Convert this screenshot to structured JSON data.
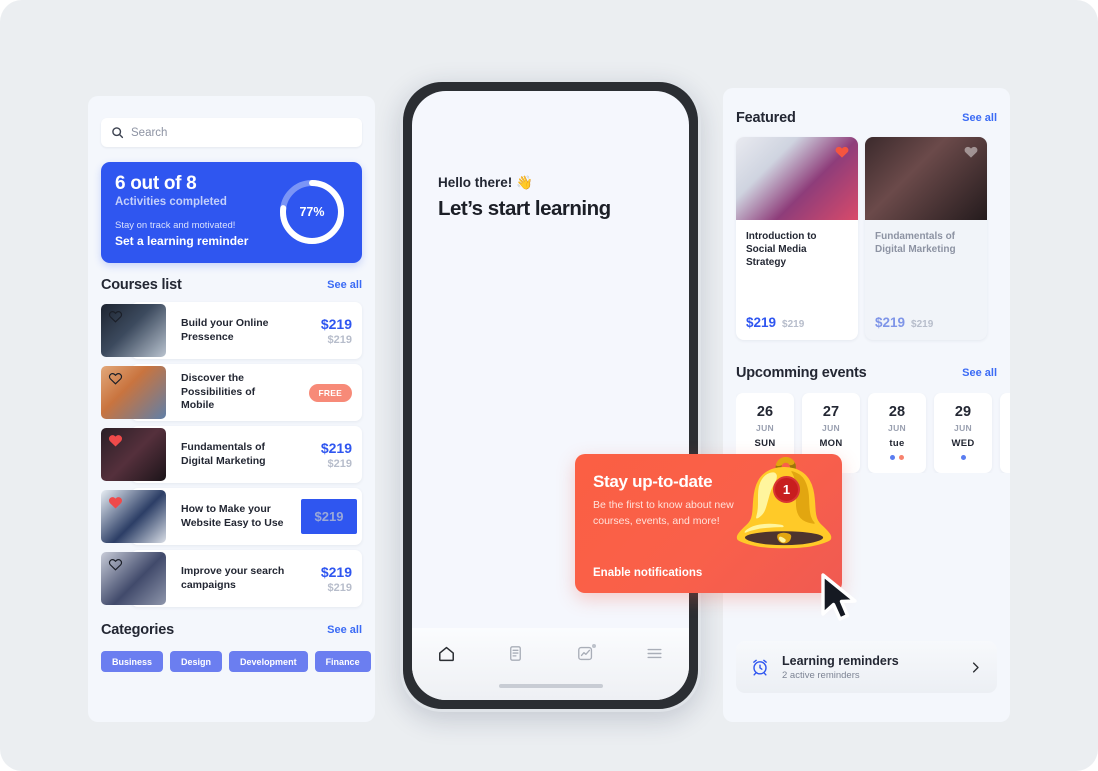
{
  "colors": {
    "background": "#ebeef1",
    "panel": "#f4f7fc",
    "accent_blue": "#2f56f0",
    "link_blue": "#3b6bf5",
    "chip_blue": "#6b7ef0",
    "coral": "#f78a78",
    "tooltip_red": "#f9604a",
    "text_dark": "#232733",
    "text_muted": "#8d93a3",
    "price_old": "#b7bdcb"
  },
  "left_panel": {
    "search": {
      "placeholder": "Search",
      "icon": "search-icon"
    },
    "progress_card": {
      "headline": "6 out of 8",
      "subhead": "Activities completed",
      "note": "Stay on track and motivated!",
      "cta": "Set a learning reminder",
      "percent_label": "77%",
      "percent_value": 77
    },
    "courses_section": {
      "title": "Courses list",
      "see_all": "See all"
    },
    "courses": [
      {
        "title": "Build your Online Pressence",
        "price": "$219",
        "price_old": "$219",
        "badge": "",
        "favorite": false,
        "highlighted": false
      },
      {
        "title": "Discover the Possibilities of Mobile",
        "price": "",
        "price_old": "",
        "badge": "FREE",
        "favorite": false,
        "highlighted": false
      },
      {
        "title": "Fundamentals of Digital Marketing",
        "price": "$219",
        "price_old": "$219",
        "badge": "",
        "favorite": true,
        "highlighted": false
      },
      {
        "title": "How to Make your Website Easy to Use",
        "price": "$219",
        "price_old": "",
        "badge": "",
        "favorite": true,
        "highlighted": true
      },
      {
        "title": "Improve your search campaigns",
        "price": "$219",
        "price_old": "$219",
        "badge": "",
        "favorite": false,
        "highlighted": false
      }
    ],
    "categories_section": {
      "title": "Categories",
      "see_all": "See all"
    },
    "categories": [
      "Business",
      "Design",
      "Development",
      "Finance"
    ]
  },
  "phone": {
    "greeting": "Hello there! 👋",
    "headline": "Let’s start learning",
    "tabs": [
      {
        "name": "home-icon",
        "active": true
      },
      {
        "name": "documents-icon",
        "active": false
      },
      {
        "name": "analytics-icon",
        "active": false,
        "badge": true
      },
      {
        "name": "menu-icon",
        "active": false
      }
    ]
  },
  "right_panel": {
    "featured_section": {
      "title": "Featured",
      "see_all": "See all"
    },
    "featured": [
      {
        "title": "Introduction to Social Media Strategy",
        "price": "$219",
        "price_old": "$219",
        "favorite": true,
        "muted": false
      },
      {
        "title": "Fundamentals of Digital Marketing",
        "price": "$219",
        "price_old": "$219",
        "favorite": false,
        "muted": true
      }
    ],
    "events_section": {
      "title": "Upcomming events",
      "see_all": "See all"
    },
    "events": [
      {
        "day": "26",
        "month": "JUN",
        "dow": "SUN",
        "dots": []
      },
      {
        "day": "27",
        "month": "JUN",
        "dow": "MON",
        "dots": []
      },
      {
        "day": "28",
        "month": "JUN",
        "dow": "tue",
        "dots": [
          "#5a7df0",
          "#f7826e"
        ]
      },
      {
        "day": "29",
        "month": "JUN",
        "dow": "WED",
        "dots": [
          "#5a7df0"
        ]
      }
    ],
    "reminder": {
      "title": "Learning reminders",
      "subtitle": "2 active reminders",
      "icon": "alarm-clock-icon",
      "chevron": "chevron-right-icon"
    }
  },
  "tooltip": {
    "title": "Stay up-to-date",
    "body": "Be the first to know about new courses, events, and more!",
    "cta": "Enable notifications",
    "badge_count": "1",
    "icon": "bell-icon"
  }
}
